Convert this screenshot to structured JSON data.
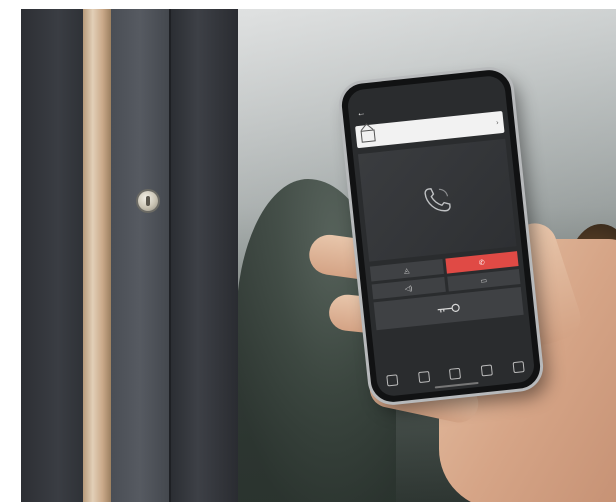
{
  "scene": {
    "colors": {
      "door": "#3a3d43",
      "wood_strip": "#e2cfb7",
      "accent_red": "#e04a45"
    }
  },
  "phone": {
    "status_time": "",
    "app_bar": {
      "title": "",
      "back_icon": "back-arrow-icon",
      "right_text": ""
    },
    "door_card": {
      "label": "",
      "icon": "house-icon",
      "chevron": "›"
    },
    "call_area_icon": "handset-icon",
    "controls": [
      {
        "name": "camera-control",
        "glyph": "◬",
        "accent": false
      },
      {
        "name": "hangup-control",
        "glyph": "✆",
        "accent": true
      },
      {
        "name": "speaker-control",
        "glyph": "◁)",
        "accent": false
      },
      {
        "name": "mic-control",
        "glyph": "▭",
        "accent": false
      }
    ],
    "door_open_icon": "key-icon",
    "nav": [
      {
        "name": "nav-home",
        "label": ""
      },
      {
        "name": "nav-doors",
        "label": ""
      },
      {
        "name": "nav-messages",
        "label": ""
      },
      {
        "name": "nav-settings",
        "label": ""
      },
      {
        "name": "nav-info",
        "label": ""
      }
    ]
  }
}
